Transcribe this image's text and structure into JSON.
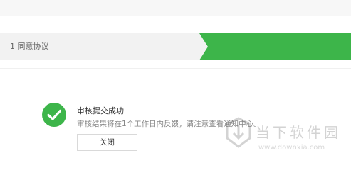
{
  "steps": {
    "current_label": "1 同意协议",
    "accent_color": "#3db54a"
  },
  "result": {
    "icon": "checkmark-circle-icon",
    "title": "审核提交成功",
    "description": "审核结果将在1个工作日内反馈，请注意查看通知中心。",
    "close_label": "关闭"
  },
  "watermark": {
    "name": "当下软件园",
    "url": "www.downxia.com"
  }
}
